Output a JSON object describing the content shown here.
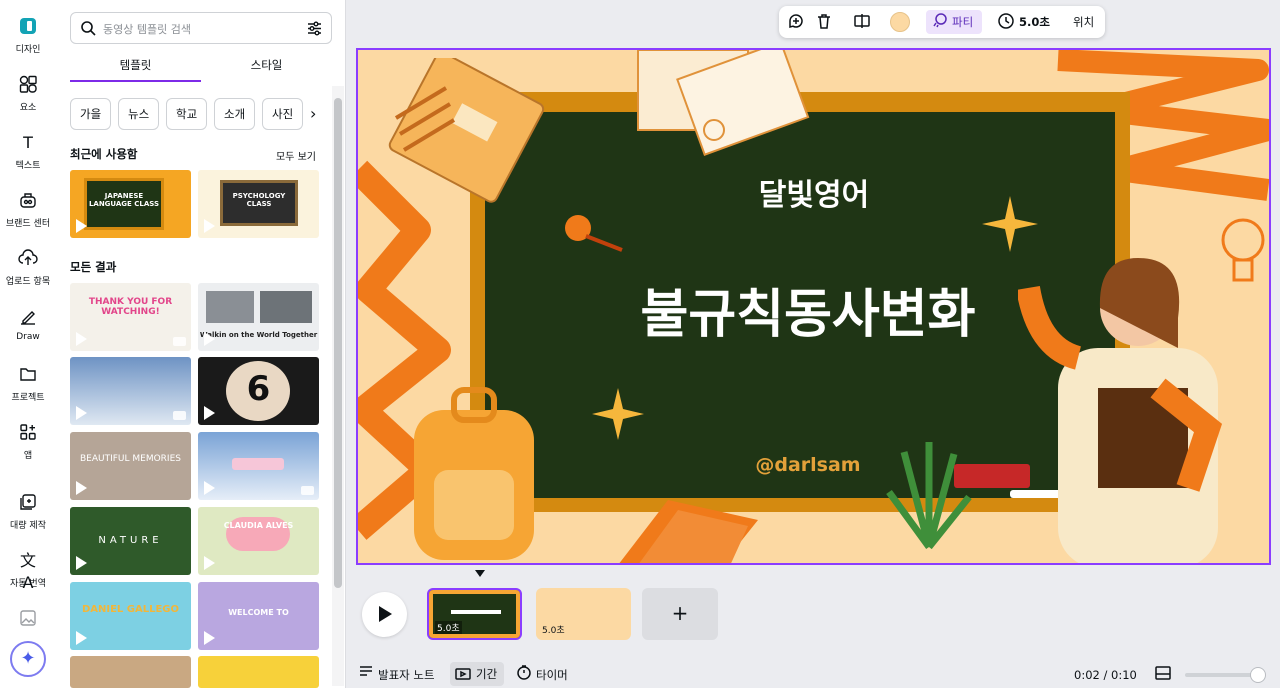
{
  "rail": {
    "items": [
      {
        "label": "디자인",
        "icon": "design-icon"
      },
      {
        "label": "요소",
        "icon": "elements-icon"
      },
      {
        "label": "텍스트",
        "icon": "text-icon"
      },
      {
        "label": "브랜드 센터",
        "icon": "brand-icon"
      },
      {
        "label": "업로드 항목",
        "icon": "upload-icon"
      },
      {
        "label": "Draw",
        "icon": "draw-icon"
      },
      {
        "label": "프로젝트",
        "icon": "folder-icon"
      },
      {
        "label": "앱",
        "icon": "apps-icon"
      },
      {
        "label": "대량 제작",
        "icon": "bulk-create-icon"
      },
      {
        "label": "자동 번역",
        "icon": "translate-icon"
      }
    ]
  },
  "panel": {
    "search_placeholder": "동영상 템플릿 검색",
    "tabs": [
      "템플릿",
      "스타일"
    ],
    "chips": [
      "가을",
      "뉴스",
      "학교",
      "소개",
      "사진"
    ],
    "recent_title": "최근에 사용함",
    "see_all": "모두 보기",
    "all_results_title": "모든 결과",
    "recent": [
      {
        "text": "JAPANESE LANGUAGE CLASS"
      },
      {
        "text": "PSYCHOLOGY CLASS"
      }
    ],
    "results": [
      {
        "text": "THANK YOU FOR WATCHING!"
      },
      {
        "text": "Walkin on the World Together"
      },
      {
        "text": ""
      },
      {
        "text": "6"
      },
      {
        "text": "BEAUTIFUL MEMORIES"
      },
      {
        "text": ""
      },
      {
        "text": "NATURE"
      },
      {
        "text": "CLAUDIA ALVES"
      },
      {
        "text": "DANIEL GALLEGO"
      },
      {
        "text": "WELCOME TO"
      },
      {
        "text": ""
      },
      {
        "text": ""
      }
    ]
  },
  "toolbar": {
    "party_label": "파티",
    "duration_label": "5.0초",
    "position_label": "위치",
    "color_swatch": "#fcd9a3"
  },
  "slide": {
    "subtitle": "달빛영어",
    "title": "불규칙동사변화",
    "handle": "@darlsam"
  },
  "timeline": {
    "clips": [
      {
        "duration": "5.0초"
      },
      {
        "duration": "5.0초"
      }
    ],
    "add_label": "+",
    "time_readout": "0:02 / 0:10"
  },
  "bottom_bar": {
    "notes_label": "발표자 노트",
    "duration_label": "기간",
    "timer_label": "타이머"
  },
  "colors": {
    "accent": "#8b3dff",
    "board": "#1f3515",
    "frame": "#d48a10",
    "orange": "#f07a1a",
    "cream": "#fcd9a3"
  }
}
